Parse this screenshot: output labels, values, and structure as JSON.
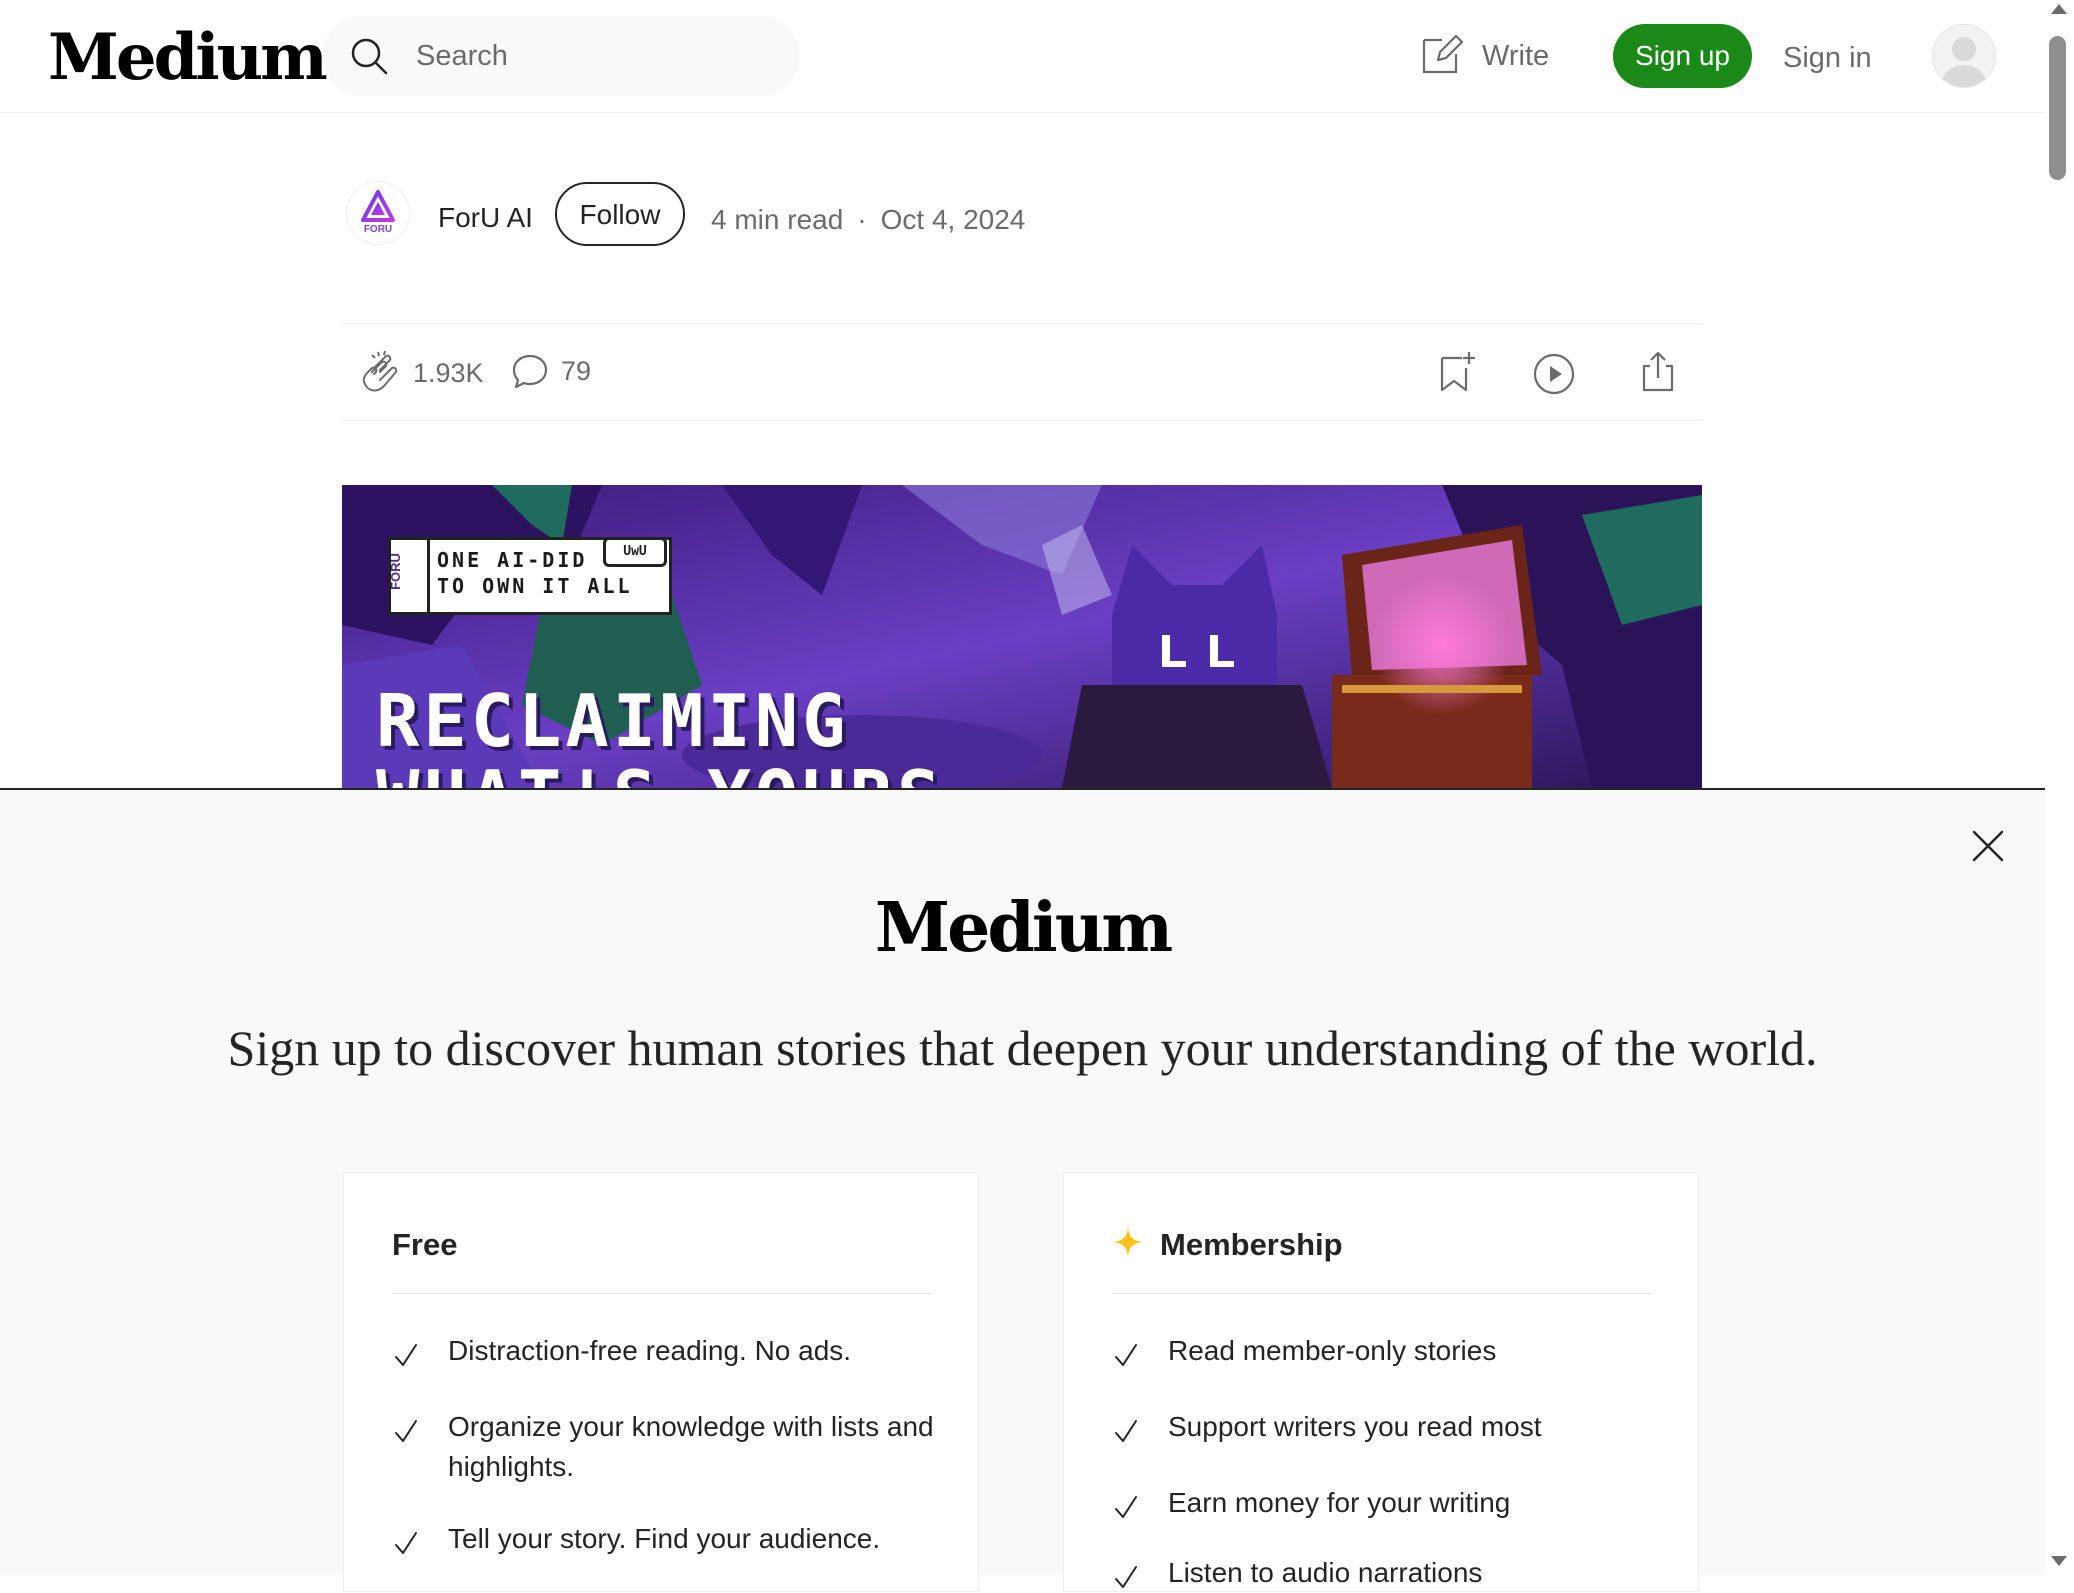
{
  "header": {
    "logo": "Medium",
    "search_placeholder": "Search",
    "write_label": "Write",
    "signup_label": "Sign up",
    "signin_label": "Sign in"
  },
  "article": {
    "author": "ForU AI",
    "author_logo_text": "FORU",
    "follow_label": "Follow",
    "read_time": "4 min read",
    "separator": "·",
    "date": "Oct 4, 2024",
    "claps": "1.93K",
    "responses": "79",
    "hero": {
      "badge_brand": "FORU",
      "badge_line1": "ONE AI-DID",
      "badge_line2": "TO OWN IT ALL",
      "badge_tag": "UwU",
      "headline_line1": "RECLAIMING",
      "headline_line2": "WHAT'S YOURS"
    }
  },
  "overlay": {
    "logo": "Medium",
    "tagline": "Sign up to discover human stories that deepen your understanding of the world.",
    "free": {
      "title": "Free",
      "features": [
        "Distraction-free reading. No ads.",
        "Organize your knowledge with lists and highlights.",
        "Tell your story. Find your audience."
      ]
    },
    "membership": {
      "title": "Membership",
      "features": [
        "Read member-only stories",
        "Support writers you read most",
        "Earn money for your writing",
        "Listen to audio narrations"
      ]
    }
  },
  "colors": {
    "brand_green": "#1a8917",
    "text_primary": "#242424",
    "text_secondary": "#6b6b6b",
    "star": "#ffc017",
    "hero_purple": "#5a2fb0"
  }
}
